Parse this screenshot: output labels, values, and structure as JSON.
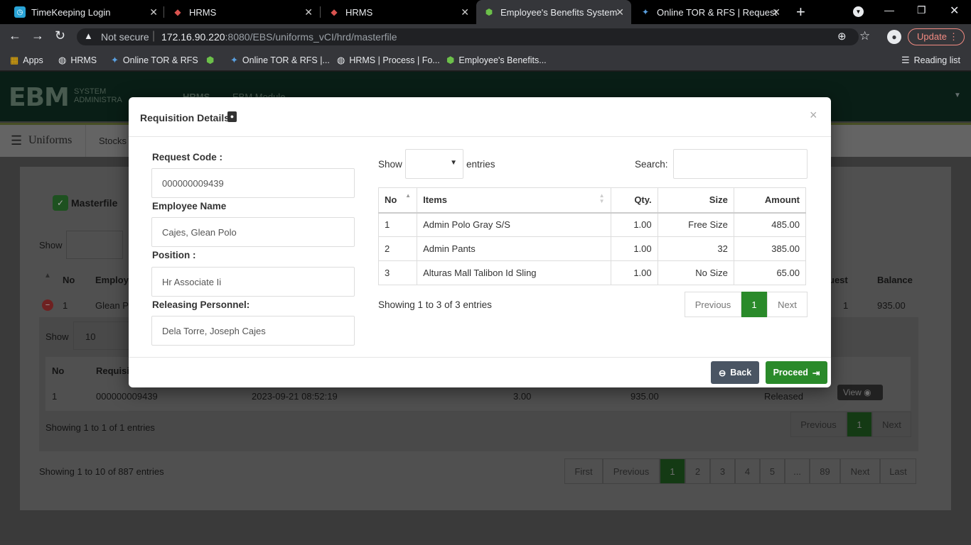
{
  "browser": {
    "tabs": [
      {
        "title": "TimeKeeping Login",
        "icon": "timekeeping-icon"
      },
      {
        "title": "HRMS",
        "icon": "hrms-icon"
      },
      {
        "title": "HRMS",
        "icon": "hrms-icon"
      },
      {
        "title": "Employee's Benefits System",
        "icon": "ebs-icon"
      },
      {
        "title": "Online TOR & RFS | Request",
        "icon": "tor-icon"
      }
    ],
    "security_label": "Not secure",
    "url_host": "172.16.90.220",
    "url_path": ":8080/EBS/uniforms_vCI/hrd/masterfile",
    "update_label": "Update",
    "bookmarks": [
      "Apps",
      "HRMS",
      "Online TOR & RFS",
      "Online TOR & RFS |...",
      "HRMS | Process | Fo...",
      "Employee's Benefits..."
    ],
    "reading_list": "Reading list"
  },
  "app": {
    "logo_text": "EBM",
    "logo_sub1": "SYSTEM",
    "logo_sub2": "ADMINISTRA",
    "nav_hrms": "HRMS",
    "nav_module": "EBM Module",
    "subnav_title": "Uniforms",
    "subnav_stocks": "Stocks"
  },
  "background": {
    "masterfile_title": "Masterfile",
    "show_label": "Show",
    "col_no": "No",
    "col_employee": "Employ",
    "col_request": "uest",
    "col_balance": "Balance",
    "row": {
      "no": "1",
      "name": "Glean P",
      "request": "1",
      "balance": "935.00"
    },
    "inner_show": "Show",
    "inner_show_value": "10",
    "inner_col_no": "No",
    "inner_col_req": "Requisi",
    "inner_row": {
      "no": "1",
      "code": "000000009439",
      "date": "2023-09-21 08:52:19",
      "qty": "3.00",
      "amount": "935.00",
      "status": "Released",
      "view": "View"
    },
    "inner_showing": "Showing 1 to 1 of 1 entries",
    "inner_prev": "Previous",
    "inner_page": "1",
    "inner_next": "Next",
    "showing": "Showing 1 to 10 of 887 entries",
    "pagination": [
      "First",
      "Previous",
      "1",
      "2",
      "3",
      "4",
      "5",
      "...",
      "89",
      "Next",
      "Last"
    ]
  },
  "modal": {
    "title": "Requisition Details",
    "close": "×",
    "request_code_label": "Request Code :",
    "request_code": "000000009439",
    "employee_name_label": "Employee Name",
    "employee_name": "Cajes, Glean Polo",
    "position_label": "Position :",
    "position": "Hr Associate Ii",
    "releasing_label": "Releasing Personnel:",
    "releasing": "Dela Torre, Joseph Cajes",
    "show_label": "Show",
    "entries_label": "entries",
    "search_label": "Search:",
    "columns": [
      "No",
      "Items",
      "Qty.",
      "Size",
      "Amount"
    ],
    "rows": [
      {
        "no": "1",
        "item": "Admin Polo Gray S/S",
        "qty": "1.00",
        "size": "Free Size",
        "amount": "485.00"
      },
      {
        "no": "2",
        "item": "Admin Pants",
        "qty": "1.00",
        "size": "32",
        "amount": "385.00"
      },
      {
        "no": "3",
        "item": "Alturas Mall Talibon Id Sling",
        "qty": "1.00",
        "size": "No Size",
        "amount": "65.00"
      }
    ],
    "showing": "Showing 1 to 3 of 3 entries",
    "prev": "Previous",
    "page": "1",
    "next": "Next",
    "back_label": "Back",
    "proceed_label": "Proceed"
  }
}
